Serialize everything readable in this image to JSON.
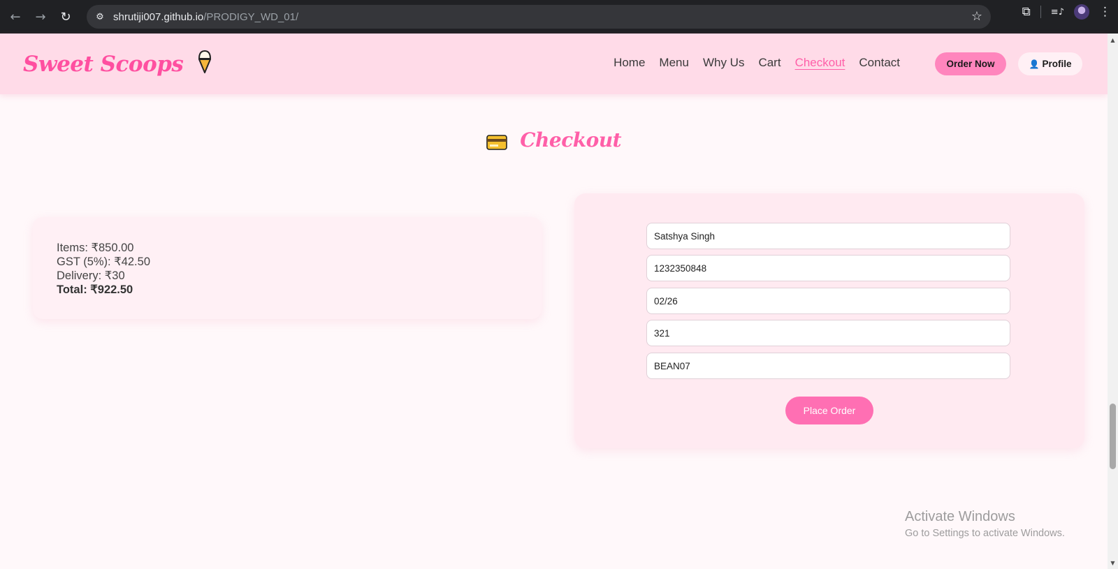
{
  "browser": {
    "url_host": "shrutiji007.github.io",
    "url_path": "/PRODIGY_WD_01/",
    "back_icon": "←",
    "forward_icon": "→",
    "reload_icon": "↻",
    "site_info_icon": "⚙",
    "star_icon": "☆",
    "extensions_icon": "⧉",
    "media_icon": "≡♪",
    "menu_icon": "⋮"
  },
  "header": {
    "logo_text": "Sweet Scoops",
    "nav": [
      {
        "label": "Home"
      },
      {
        "label": "Menu"
      },
      {
        "label": "Why Us"
      },
      {
        "label": "Cart"
      },
      {
        "label": "Checkout"
      },
      {
        "label": "Contact"
      }
    ],
    "order_button": "Order Now",
    "profile_button": "Profile",
    "profile_icon": "👤"
  },
  "page": {
    "title": "Checkout"
  },
  "summary": {
    "items": "Items: ₹850.00",
    "gst": "GST (5%): ₹42.50",
    "delivery": "Delivery: ₹30",
    "total": "Total: ₹922.50"
  },
  "form": {
    "name": "Satshya Singh",
    "card_number": "1232350848",
    "expiry": "02/26",
    "cvv": "321",
    "promo": "BEAN07",
    "submit_label": "Place Order"
  },
  "watermark": {
    "title": "Activate Windows",
    "subtitle": "Go to Settings to activate Windows."
  },
  "colors": {
    "brand_pink": "#ff5fa8",
    "header_bg": "#ffdbe8",
    "button_pink": "#ff6fb3"
  }
}
